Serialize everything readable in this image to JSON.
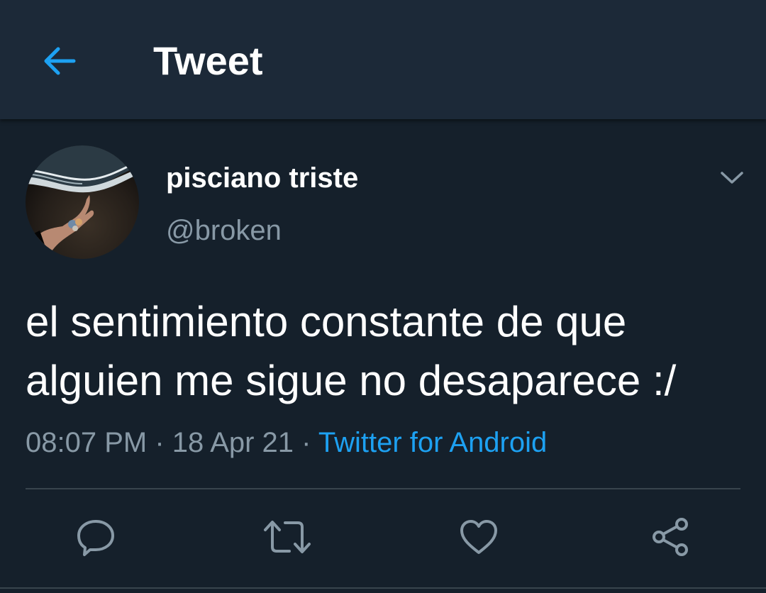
{
  "header": {
    "title": "Tweet",
    "back_icon": "arrow-left-icon"
  },
  "tweet": {
    "author": {
      "display_name": "pisciano triste",
      "handle": "@broken"
    },
    "text_lines": [
      "el sentimiento constante de que",
      "alguien me sigue no desaparece :/"
    ],
    "time": "08:07 PM",
    "date": "18 Apr 21",
    "separator": "·",
    "source": "Twitter for Android"
  },
  "actions": [
    {
      "name": "reply",
      "icon": "speech-bubble-icon"
    },
    {
      "name": "retweet",
      "icon": "retweet-icon"
    },
    {
      "name": "like",
      "icon": "heart-icon"
    },
    {
      "name": "share",
      "icon": "share-icon"
    }
  ],
  "colors": {
    "background": "#15202b",
    "header_background": "#1c2938",
    "accent": "#1da1f2",
    "secondary_text": "#8899a6",
    "primary_text": "#ffffff",
    "divider": "#38444d"
  }
}
